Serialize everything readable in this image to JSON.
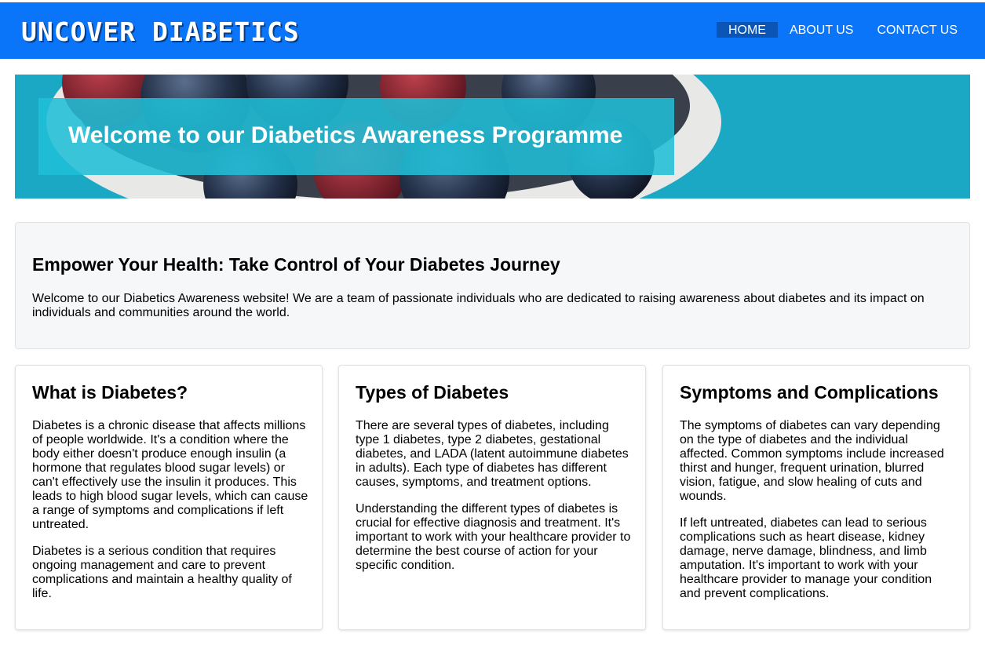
{
  "header": {
    "brand": "UNCOVER DIABETICS",
    "nav": [
      {
        "label": "HOME",
        "active": true
      },
      {
        "label": "ABOUT US",
        "active": false
      },
      {
        "label": "CONTACT US",
        "active": false
      }
    ]
  },
  "hero": {
    "title": "Welcome to our Diabetics Awareness Programme"
  },
  "intro": {
    "heading": "Empower Your Health: Take Control of Your Diabetes Journey",
    "text": "Welcome to our Diabetics Awareness website! We are a team of passionate individuals who are dedicated to raising awareness about diabetes and its impact on individuals and communities around the world."
  },
  "cards": [
    {
      "title": "What is Diabetes?",
      "paragraphs": [
        "Diabetes is a chronic disease that affects millions of people worldwide. It's a condition where the body either doesn't produce enough insulin (a hormone that regulates blood sugar levels) or can't effectively use the insulin it produces. This leads to high blood sugar levels, which can cause a range of symptoms and complications if left untreated.",
        "Diabetes is a serious condition that requires ongoing management and care to prevent complications and maintain a healthy quality of life."
      ]
    },
    {
      "title": "Types of Diabetes",
      "paragraphs": [
        "There are several types of diabetes, including type 1 diabetes, type 2 diabetes, gestational diabetes, and LADA (latent autoimmune diabetes in adults). Each type of diabetes has different causes, symptoms, and treatment options.",
        "Understanding the different types of diabetes is crucial for effective diagnosis and treatment. It's important to work with your healthcare provider to determine the best course of action for your specific condition."
      ]
    },
    {
      "title": "Symptoms and Complications",
      "paragraphs": [
        "The symptoms of diabetes can vary depending on the type of diabetes and the individual affected. Common symptoms include increased thirst and hunger, frequent urination, blurred vision, fatigue, and slow healing of cuts and wounds.",
        "If left untreated, diabetes can lead to serious complications such as heart disease, kidney damage, nerve damage, blindness, and limb amputation. It's important to work with your healthcare provider to manage your condition and prevent complications."
      ]
    }
  ]
}
